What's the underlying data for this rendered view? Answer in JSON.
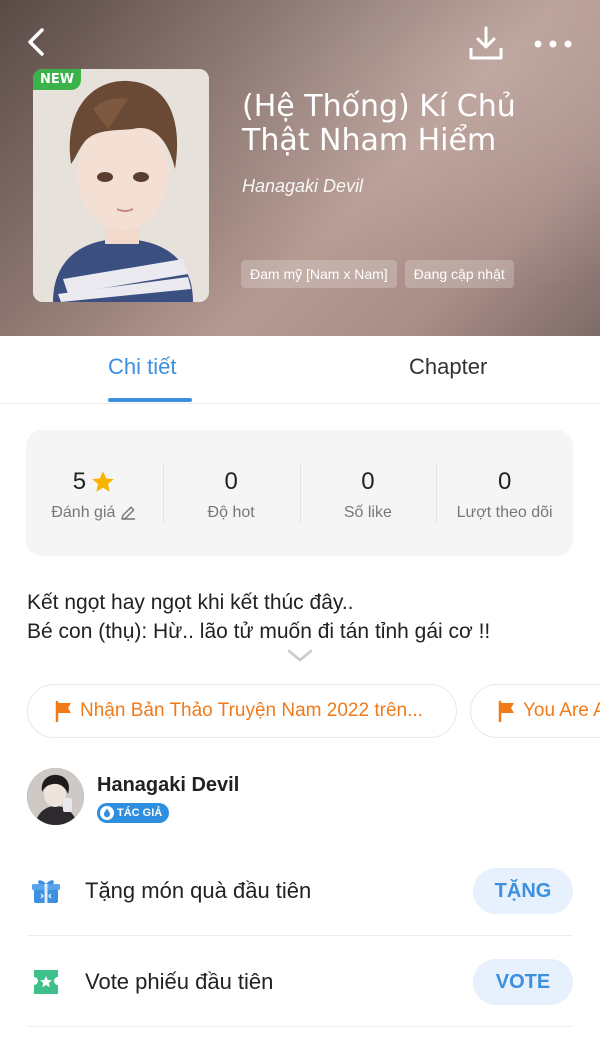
{
  "header": {
    "back_icon": "chevron-left-icon",
    "download_icon": "download-icon",
    "more_icon": "more-dots-icon"
  },
  "book": {
    "badge": "NEW",
    "title": "(Hệ Thống) Kí Chủ Thật Nham Hiểm",
    "author": "Hanagaki Devil",
    "tags": [
      "Đam mỹ [Nam x Nam]",
      "Đang cập nhật"
    ]
  },
  "tabs": {
    "detail": "Chi tiết",
    "chapter": "Chapter",
    "active": "detail"
  },
  "stats": [
    {
      "value": "5",
      "label": "Đánh giá",
      "icon": "star-icon"
    },
    {
      "value": "0",
      "label": "Độ hot"
    },
    {
      "value": "0",
      "label": "Số like"
    },
    {
      "value": "0",
      "label": "Lượt theo dõi"
    }
  ],
  "description": {
    "line1": "Kết ngọt hay ngọt khi kết thúc đây..",
    "line2": "Bé con (thụ): Hừ.. lão tử muốn đi tán tỉnh gái cơ !!"
  },
  "awards": [
    {
      "label": "Nhận Bản Thảo Truyện Nam 2022 trên..."
    },
    {
      "label": "You Are A"
    }
  ],
  "author_info": {
    "name": "Hanagaki Devil",
    "badge": "TÁC GIẢ"
  },
  "actions": {
    "gift_label": "Tặng món quà đầu tiên",
    "gift_button": "TẶNG",
    "vote_label": "Vote phiếu đầu tiên",
    "vote_button": "VOTE"
  },
  "colors": {
    "accent": "#3d8fe0",
    "award_orange": "#f07a1a",
    "new_badge": "#3bb34a",
    "star": "#f7b500"
  }
}
